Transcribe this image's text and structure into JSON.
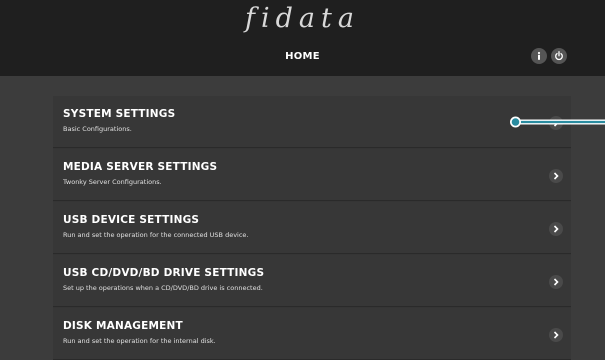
{
  "header": {
    "brand": "fidata",
    "title": "HOME",
    "info_icon": "info-icon",
    "power_icon": "power-icon"
  },
  "menu": {
    "items": [
      {
        "title": "SYSTEM SETTINGS",
        "description": "Basic Configurations."
      },
      {
        "title": "MEDIA SERVER SETTINGS",
        "description": "Twonky Server Configurations."
      },
      {
        "title": "USB DEVICE SETTINGS",
        "description": "Run and set the operation for the connected USB device."
      },
      {
        "title": "USB CD/DVD/BD DRIVE SETTINGS",
        "description": "Set up the operations when a CD/DVD/BD drive is connected."
      },
      {
        "title": "DISK MANAGEMENT",
        "description": "Run and set the operation for the internal disk."
      }
    ],
    "chevron_icon": "chevron-right-icon"
  },
  "colors": {
    "header_bg": "#1f1f1f",
    "page_bg": "#3c3c3c",
    "callout": "#2a8ca0"
  }
}
